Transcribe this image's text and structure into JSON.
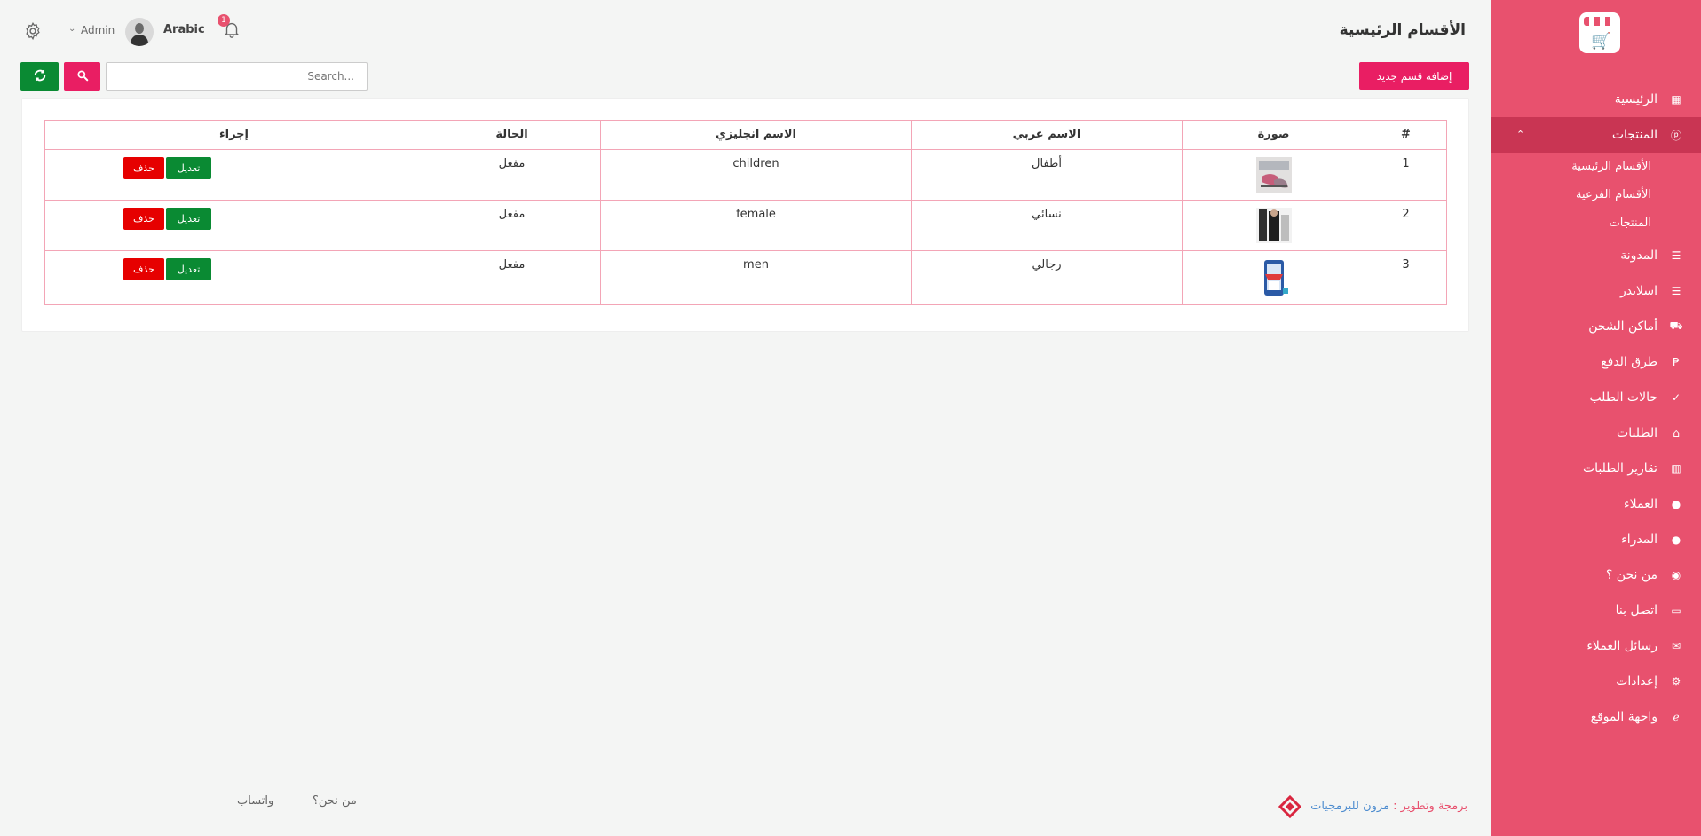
{
  "header": {
    "page_title": "الأقسام الرئيسية",
    "language": "Arabic",
    "user_name": "Admin",
    "notification_count": "1"
  },
  "toolbar": {
    "add_label": "إضافة قسم جديد",
    "search_placeholder": "Search..."
  },
  "sidebar": {
    "items": [
      {
        "label": "الرئيسية",
        "icon": "dashboard-icon"
      },
      {
        "label": "المنتجات",
        "icon": "product-icon",
        "active": true
      },
      {
        "label": "المدونة",
        "icon": "sliders-icon"
      },
      {
        "label": "اسلايدر",
        "icon": "sliders-icon"
      },
      {
        "label": "أماكن الشحن",
        "icon": "truck-icon"
      },
      {
        "label": "طرق الدفع",
        "icon": "paypal-icon"
      },
      {
        "label": "حالات الطلب",
        "icon": "check-circle-icon"
      },
      {
        "label": "الطلبات",
        "icon": "basket-icon"
      },
      {
        "label": "تقارير الطلبات",
        "icon": "chart-icon"
      },
      {
        "label": "العملاء",
        "icon": "user-icon"
      },
      {
        "label": "المدراء",
        "icon": "user-icon"
      },
      {
        "label": "من نحن ؟",
        "icon": "eye-icon"
      },
      {
        "label": "اتصل بنا",
        "icon": "id-card-icon"
      },
      {
        "label": "رسائل العملاء",
        "icon": "envelope-icon"
      },
      {
        "label": "إعدادات",
        "icon": "gear-icon"
      },
      {
        "label": "واجهة الموقع",
        "icon": "internet-explorer-icon"
      }
    ],
    "products_submenu": [
      "الأقسام الرئيسية",
      "الأقسام الفرعية",
      "المنتجات"
    ]
  },
  "table": {
    "headers": [
      "#",
      "صورة",
      "الاسم عربي",
      "الاسم انجليزي",
      "الحالة",
      "إجراء"
    ],
    "rows": [
      {
        "id": "1",
        "name_ar": "أطفال",
        "name_en": "children",
        "status": "مفعل"
      },
      {
        "id": "2",
        "name_ar": "نسائي",
        "name_en": "female",
        "status": "مفعل"
      },
      {
        "id": "3",
        "name_ar": "رجالي",
        "name_en": "men",
        "status": "مفعل"
      }
    ],
    "edit_label": "تعديل",
    "delete_label": "حذف"
  },
  "footer": {
    "credit_prefix": "برمجة وتطوير :",
    "credit_brand": "مزون للبرمجيات",
    "about_link": "من نحن؟",
    "whatsapp_link": "واتساب"
  },
  "colors": {
    "sidebar_bg": "#e8516e",
    "sidebar_active": "#c93553",
    "primary_button": "#e91e63",
    "success_button": "#0a8a33",
    "danger_button": "#e60000",
    "table_border": "#f3a5b6"
  }
}
